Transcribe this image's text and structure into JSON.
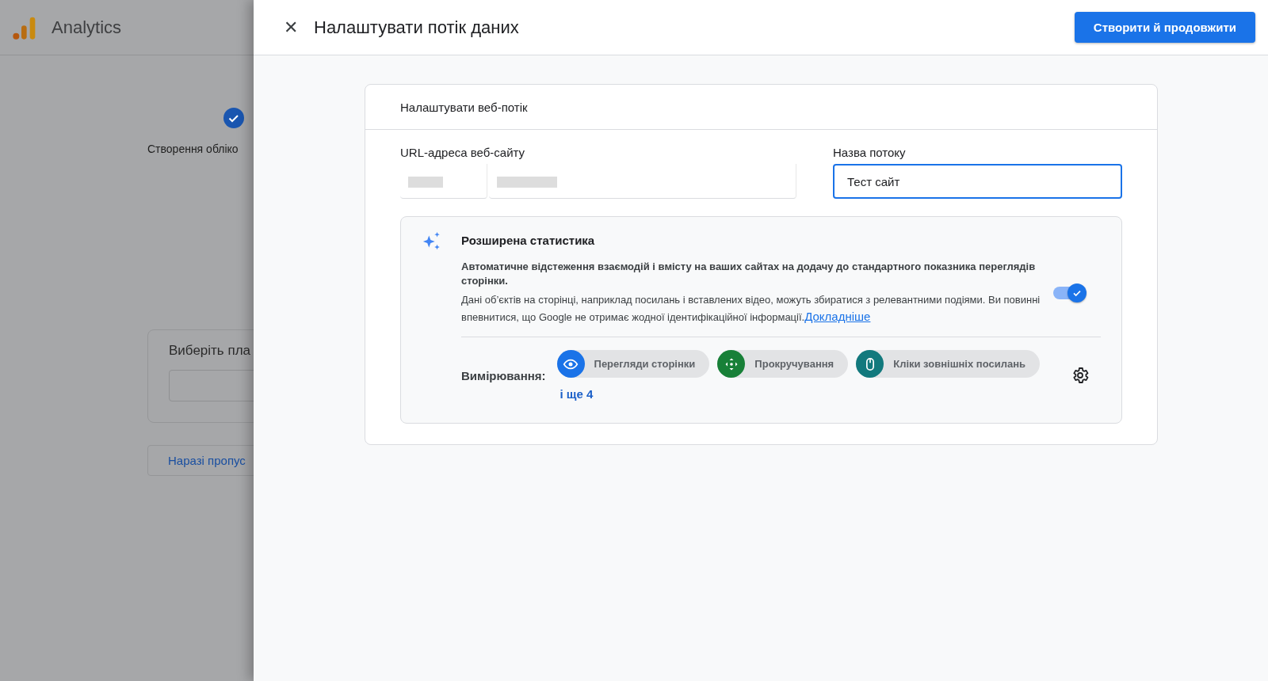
{
  "background": {
    "app_name": "Analytics",
    "step": {
      "label": "Створення обліко",
      "done": true
    },
    "platform_card": {
      "title": "Виберіть пла"
    },
    "skip_button": "Наразі пропус"
  },
  "panel": {
    "title": "Налаштувати потік даних",
    "close": "✕",
    "primary_button": "Створити й продовжити"
  },
  "card": {
    "title": "Налаштувати веб-потік",
    "url_field": {
      "label": "URL-адреса веб-сайту"
    },
    "name_field": {
      "label": "Назва потоку",
      "value": "Тест сайт"
    },
    "enhanced": {
      "title": "Розширена статистика",
      "on": true,
      "description": "Автоматичне відстеження взаємодій і вмісту на ваших сайтах на додачу до стандартного показника переглядів сторінки.",
      "note": "Дані об’єктів на сторінці, наприклад посилань і вставлених відео, можуть збиратися з релевантними подіями. Ви повинні впевнитися, що Google не отримає жодної ідентифікаційної інформації.",
      "link": "Докладніше",
      "measurements_label": "Вимірювання:",
      "chips": [
        {
          "kind": "eye",
          "label": "Перегляди сторінки",
          "color": "#1a73e8"
        },
        {
          "kind": "scroll",
          "label": "Прокручування",
          "color": "#188038"
        },
        {
          "kind": "mouse",
          "label": "Кліки зовнішніх посилань",
          "color": "#12797d"
        }
      ],
      "more": "і ще 4"
    }
  }
}
